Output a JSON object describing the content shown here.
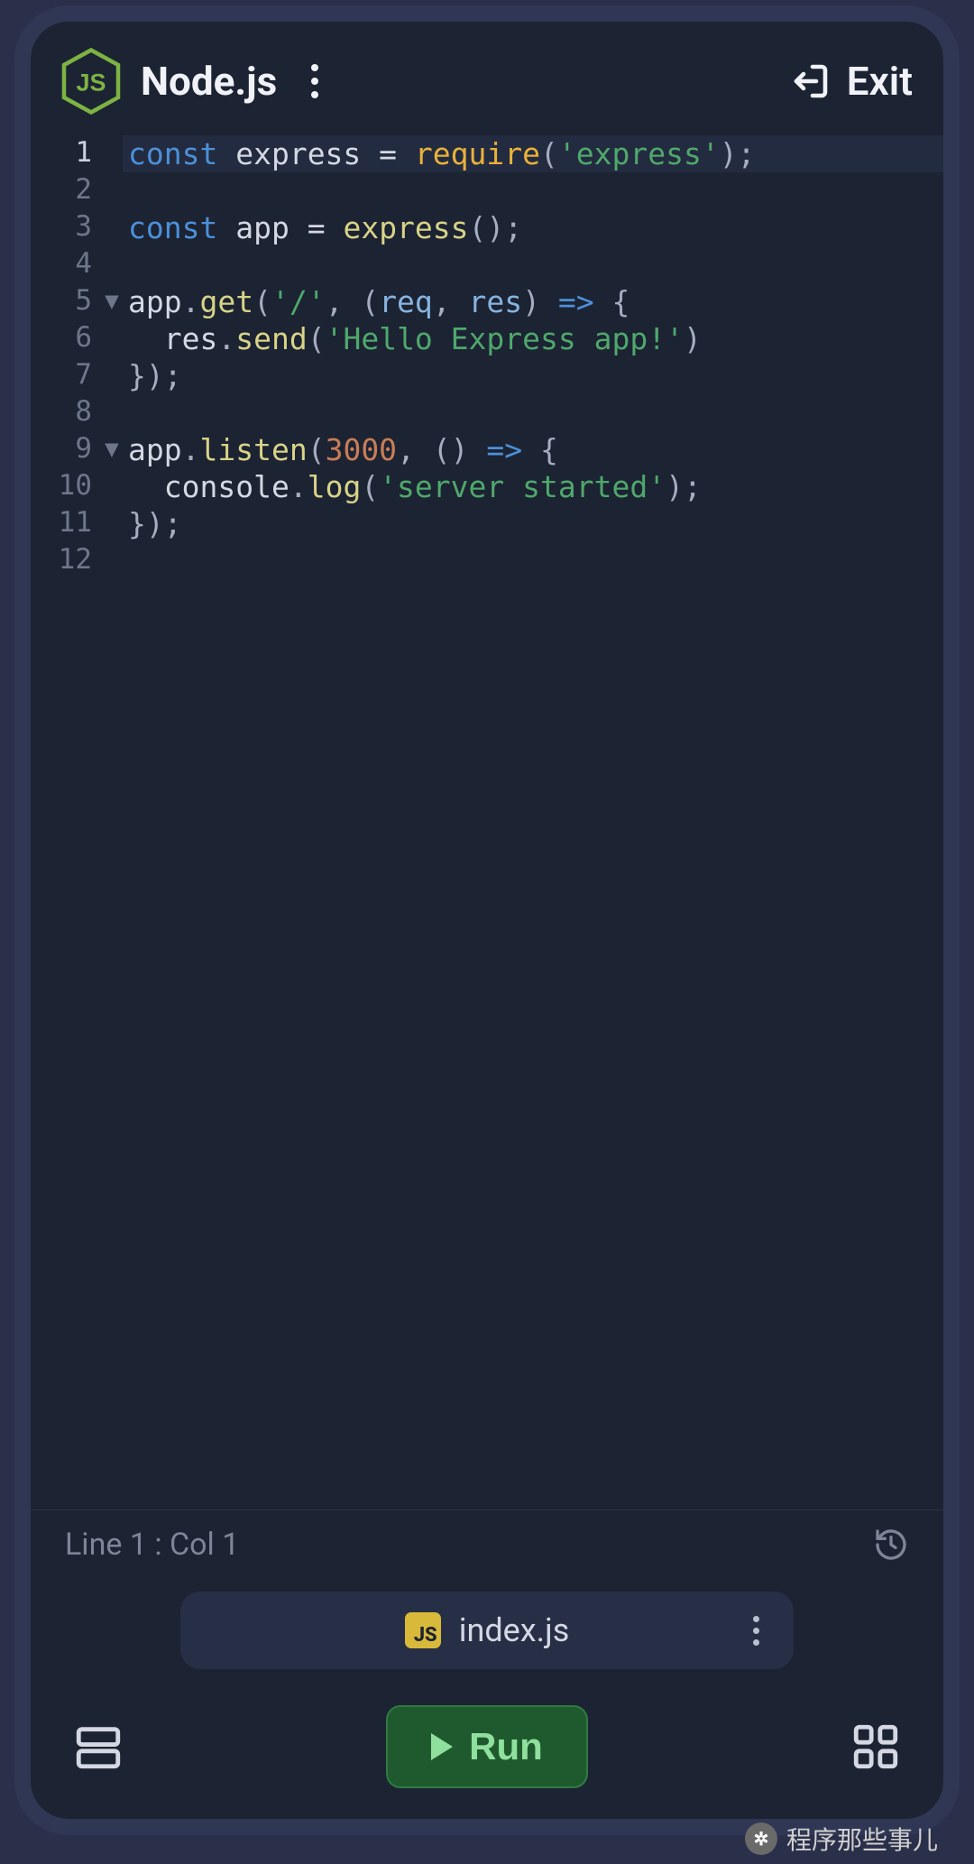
{
  "header": {
    "title": "Node.js",
    "exit_label": "Exit"
  },
  "editor": {
    "lines": [
      {
        "n": 1,
        "fold": "",
        "active": true,
        "tokens": [
          {
            "t": "const",
            "c": "tok-kw"
          },
          {
            "t": " ",
            "c": ""
          },
          {
            "t": "express",
            "c": "tok-var"
          },
          {
            "t": " ",
            "c": ""
          },
          {
            "t": "=",
            "c": "tok-op"
          },
          {
            "t": " ",
            "c": ""
          },
          {
            "t": "require",
            "c": "tok-fn"
          },
          {
            "t": "(",
            "c": "tok-punc"
          },
          {
            "t": "'express'",
            "c": "tok-str"
          },
          {
            "t": ")",
            "c": "tok-punc"
          },
          {
            "t": ";",
            "c": "tok-punc"
          }
        ]
      },
      {
        "n": 2,
        "fold": "",
        "tokens": []
      },
      {
        "n": 3,
        "fold": "",
        "tokens": [
          {
            "t": "const",
            "c": "tok-kw"
          },
          {
            "t": " ",
            "c": ""
          },
          {
            "t": "app",
            "c": "tok-var"
          },
          {
            "t": " ",
            "c": ""
          },
          {
            "t": "=",
            "c": "tok-op"
          },
          {
            "t": " ",
            "c": ""
          },
          {
            "t": "express",
            "c": "tok-call"
          },
          {
            "t": "()",
            "c": "tok-punc"
          },
          {
            "t": ";",
            "c": "tok-punc"
          }
        ]
      },
      {
        "n": 4,
        "fold": "",
        "tokens": []
      },
      {
        "n": 5,
        "fold": "▼",
        "tokens": [
          {
            "t": "app",
            "c": "tok-var"
          },
          {
            "t": ".",
            "c": "tok-punc"
          },
          {
            "t": "get",
            "c": "tok-call"
          },
          {
            "t": "(",
            "c": "tok-punc"
          },
          {
            "t": "'/'",
            "c": "tok-str"
          },
          {
            "t": ", (",
            "c": "tok-punc"
          },
          {
            "t": "req",
            "c": "tok-prop"
          },
          {
            "t": ", ",
            "c": "tok-punc"
          },
          {
            "t": "res",
            "c": "tok-prop"
          },
          {
            "t": ") ",
            "c": "tok-punc"
          },
          {
            "t": "=>",
            "c": "tok-kw"
          },
          {
            "t": " {",
            "c": "tok-punc"
          }
        ]
      },
      {
        "n": 6,
        "fold": "",
        "tokens": [
          {
            "t": "  ",
            "c": ""
          },
          {
            "t": "res",
            "c": "tok-var"
          },
          {
            "t": ".",
            "c": "tok-punc"
          },
          {
            "t": "send",
            "c": "tok-call"
          },
          {
            "t": "(",
            "c": "tok-punc"
          },
          {
            "t": "'Hello Express app!'",
            "c": "tok-str"
          },
          {
            "t": ")",
            "c": "tok-punc"
          }
        ]
      },
      {
        "n": 7,
        "fold": "",
        "tokens": [
          {
            "t": "})",
            "c": "tok-punc"
          },
          {
            "t": ";",
            "c": "tok-punc"
          }
        ]
      },
      {
        "n": 8,
        "fold": "",
        "tokens": []
      },
      {
        "n": 9,
        "fold": "▼",
        "tokens": [
          {
            "t": "app",
            "c": "tok-var"
          },
          {
            "t": ".",
            "c": "tok-punc"
          },
          {
            "t": "listen",
            "c": "tok-call"
          },
          {
            "t": "(",
            "c": "tok-punc"
          },
          {
            "t": "3000",
            "c": "tok-num"
          },
          {
            "t": ", () ",
            "c": "tok-punc"
          },
          {
            "t": "=>",
            "c": "tok-kw"
          },
          {
            "t": " {",
            "c": "tok-punc"
          }
        ]
      },
      {
        "n": 10,
        "fold": "",
        "tokens": [
          {
            "t": "  ",
            "c": ""
          },
          {
            "t": "console",
            "c": "tok-var"
          },
          {
            "t": ".",
            "c": "tok-punc"
          },
          {
            "t": "log",
            "c": "tok-call"
          },
          {
            "t": "(",
            "c": "tok-punc"
          },
          {
            "t": "'server started'",
            "c": "tok-str"
          },
          {
            "t": ")",
            "c": "tok-punc"
          },
          {
            "t": ";",
            "c": "tok-punc"
          }
        ]
      },
      {
        "n": 11,
        "fold": "",
        "tokens": [
          {
            "t": "})",
            "c": "tok-punc"
          },
          {
            "t": ";",
            "c": "tok-punc"
          }
        ]
      },
      {
        "n": 12,
        "fold": "",
        "tokens": []
      }
    ]
  },
  "status": {
    "cursor": "Line 1 : Col 1"
  },
  "file_tab": {
    "badge": "JS",
    "name": "index.js"
  },
  "run": {
    "label": "Run"
  },
  "watermark": {
    "text": "程序那些事儿"
  }
}
